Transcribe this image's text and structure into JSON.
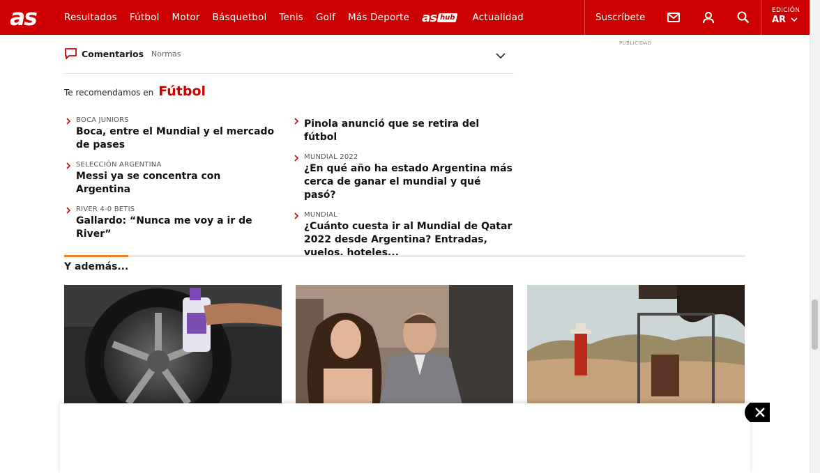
{
  "header": {
    "logo": "as",
    "nav": [
      "Resultados",
      "Fútbol",
      "Motor",
      "Básquetbol",
      "Tenis",
      "Golf",
      "Más Deporte"
    ],
    "ashub": {
      "as": "as",
      "hub": "hub"
    },
    "nav_after": "Actualidad",
    "subscribe": "Suscríbete",
    "edition_label": "EDICIÓN",
    "edition_value": "AR"
  },
  "ad_label": "PUBLICIDAD",
  "comments": {
    "label": "Comentarios",
    "rules": "Normas"
  },
  "recommended": {
    "prefix": "Te recomendamos en",
    "section": "Fútbol",
    "left": [
      {
        "kicker": "BOCA JUNIORS",
        "headline": "Boca, entre el Mundial y el mercado de pases"
      },
      {
        "kicker": "SELECCIÓN ARGENTINA",
        "headline": "Messi ya se concentra con Argentina"
      },
      {
        "kicker": "RIVER 4-0 BETIS",
        "headline": "Gallardo: “Nunca me voy a ir de River”"
      }
    ],
    "right": [
      {
        "kicker": "",
        "headline": "Pinola anunció que se retira del fútbol"
      },
      {
        "kicker": "MUNDIAL 2022",
        "headline": "¿En qué año ha estado Argentina más cerca de ganar el mundial y qué pasó?"
      },
      {
        "kicker": "MUNDIAL",
        "headline": "¿Cuánto cuesta ir al Mundial de Qatar 2022 desde Argentina? Entradas, vuelos, hoteles..."
      }
    ]
  },
  "more": {
    "title": "Y además..."
  },
  "colors": {
    "brand": "#cc0000",
    "accent": "#f57c1f"
  }
}
